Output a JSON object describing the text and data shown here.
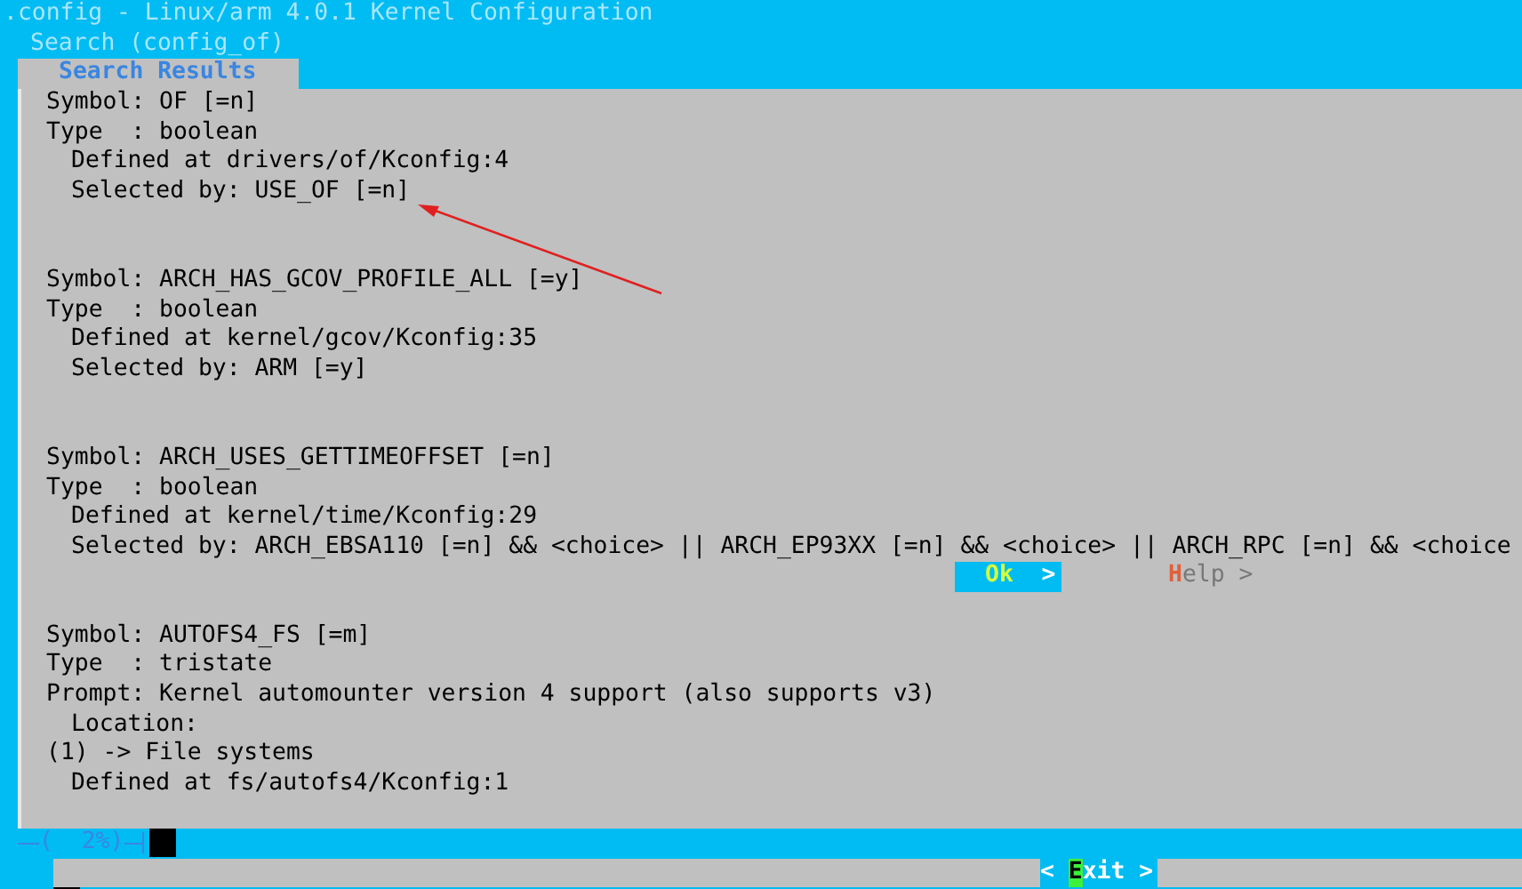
{
  "title": ".config - Linux/arm 4.0.1 Kernel Configuration",
  "subtitle": "Search (config_of)",
  "dialog": {
    "title": "Search Results",
    "results": [
      {
        "lines": [
          {
            "kind": "head",
            "text": "Symbol: OF [=n]"
          },
          {
            "kind": "head",
            "text": "Type  : boolean"
          },
          {
            "kind": "sub",
            "text": "Defined at drivers/of/Kconfig:4"
          },
          {
            "kind": "sub",
            "text": "Selected by: USE_OF [=n]"
          }
        ]
      },
      {
        "lines": [
          {
            "kind": "head",
            "text": "Symbol: ARCH_HAS_GCOV_PROFILE_ALL [=y]"
          },
          {
            "kind": "head",
            "text": "Type  : boolean"
          },
          {
            "kind": "sub",
            "text": "Defined at kernel/gcov/Kconfig:35"
          },
          {
            "kind": "sub",
            "text": "Selected by: ARM [=y]"
          }
        ]
      },
      {
        "lines": [
          {
            "kind": "head",
            "text": "Symbol: ARCH_USES_GETTIMEOFFSET [=n]"
          },
          {
            "kind": "head",
            "text": "Type  : boolean"
          },
          {
            "kind": "sub",
            "text": "Defined at kernel/time/Kconfig:29"
          },
          {
            "kind": "sub",
            "text": "Selected by: ARCH_EBSA110 [=n] && <choice> || ARCH_EP93XX [=n] && <choice> || ARCH_RPC [=n] && <choice"
          }
        ]
      },
      {
        "lines": [
          {
            "kind": "head",
            "text": "Symbol: AUTOFS4_FS [=m]"
          },
          {
            "kind": "head",
            "text": "Type  : tristate"
          },
          {
            "kind": "head",
            "text": "Prompt: Kernel automounter version 4 support (also supports v3)"
          },
          {
            "kind": "sub",
            "text": "Location:"
          },
          {
            "kind": "head",
            "text": "(1) -> File systems"
          },
          {
            "kind": "sub",
            "text": "Defined at fs/autofs4/Kconfig:1"
          }
        ]
      }
    ],
    "scroll_position": "(  2%)",
    "exit_button": {
      "prefix": "<",
      "label": "Exit",
      "suffix": ">",
      "selected": true
    }
  },
  "background_buttons": [
    {
      "label": "Ok",
      "suffix": ">",
      "selected": true
    },
    {
      "label": "Help",
      "suffix": ">",
      "selected": false
    }
  ]
}
